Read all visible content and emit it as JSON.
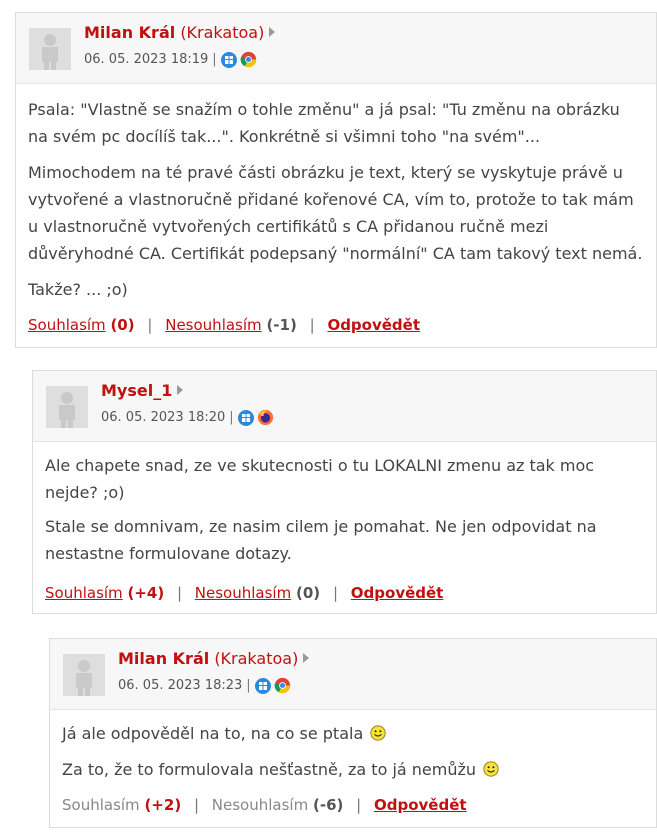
{
  "comments": [
    {
      "author": "Milan Král",
      "nick": "(Krakatoa)",
      "date": "06. 05. 2023 18:19",
      "sep": "|",
      "paragraphs": [
        "Psala: \"Vlastně se snažím o tohle změnu\" a já psal: \"Tu změnu na obrázku na svém pc docílíš tak...\". Konkrétně si všimni toho \"na svém\"...",
        "Mimochodem na té pravé části obrázku je text, který se vyskytuje právě u vytvořené a vlastnoručně přidané kořenové CA, vím to, protože to tak mám u vlastnoručně vytvořených certifikátů s CA přidanou ručně mezi důvěryhodné CA. Certifikát podepsaný \"normální\" CA tam takový text nemá.",
        "Takže? ... ;o)"
      ],
      "agree_label": "Souhlasím",
      "agree_count": "(0)",
      "disagree_label": "Nesouhlasím",
      "disagree_count": "(-1)",
      "reply_label": "Odpovědět",
      "browser_icon": "chrome-icon"
    },
    {
      "author": "Mysel_1",
      "nick": "",
      "date": "06. 05. 2023 18:20",
      "sep": "|",
      "paragraphs": [
        "Ale chapete snad, ze ve skutecnosti o tu LOKALNI zmenu az tak moc nejde? ;o)",
        "Stale se domnivam, ze nasim cilem je pomahat. Ne jen odpovidat na nestastne formulovane dotazy."
      ],
      "agree_label": "Souhlasím",
      "agree_count": "(+4)",
      "disagree_label": "Nesouhlasím",
      "disagree_count": "(0)",
      "reply_label": "Odpovědět",
      "browser_icon": "firefox-icon"
    },
    {
      "author": "Milan Král",
      "nick": "(Krakatoa)",
      "date": "06. 05. 2023 18:23",
      "sep": "|",
      "paragraphs": [
        "Já ale odpověděl na to, na co se ptala",
        "Za to, že to formulovala nešťastně, za to já nemůžu"
      ],
      "agree_label": "Souhlasím",
      "agree_count": "(+2)",
      "disagree_label": "Nesouhlasím",
      "disagree_count": "(-6)",
      "reply_label": "Odpovědět",
      "browser_icon": "chrome-icon"
    }
  ],
  "pipe": "|"
}
